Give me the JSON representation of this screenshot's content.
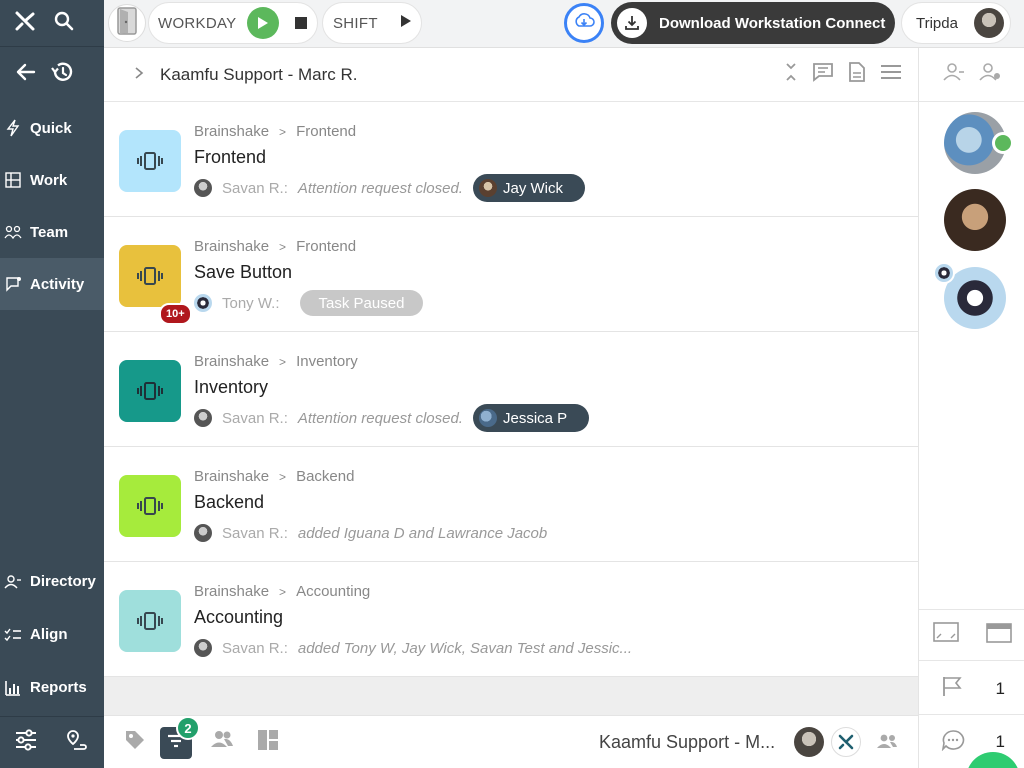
{
  "topbar": {
    "workday_label": "WORKDAY",
    "shift_label": "SHIFT",
    "download_label": "Download Workstation Connect",
    "user_name": "Tripda"
  },
  "sidebar": {
    "items": [
      {
        "label": "Quick",
        "icon": "bolt-icon"
      },
      {
        "label": "Work",
        "icon": "grid-icon"
      },
      {
        "label": "Team",
        "icon": "team-icon"
      },
      {
        "label": "Activity",
        "icon": "activity-icon",
        "active": true
      }
    ],
    "bottom_items": [
      {
        "label": "Directory",
        "icon": "directory-icon"
      },
      {
        "label": "Align",
        "icon": "align-icon"
      },
      {
        "label": "Reports",
        "icon": "reports-icon"
      }
    ]
  },
  "header": {
    "title": "Kaamfu Support - Marc R."
  },
  "activities": [
    {
      "project": "Brainshake",
      "section": "Frontend",
      "title": "Frontend",
      "actor": "Savan R.:",
      "message": "Attention request closed.",
      "chip": "Jay Wick",
      "thumb_color": "#b3e5fc"
    },
    {
      "project": "Brainshake",
      "section": "Frontend",
      "title": "Save Button",
      "actor": "Tony W.:",
      "status": "Task Paused",
      "badge": "10+",
      "thumb_color": "#e8c13d"
    },
    {
      "project": "Brainshake",
      "section": "Inventory",
      "title": "Inventory",
      "actor": "Savan R.:",
      "message": "Attention request closed.",
      "chip": "Jessica P",
      "thumb_color": "#16998a"
    },
    {
      "project": "Brainshake",
      "section": "Backend",
      "title": "Backend",
      "actor": "Savan R.:",
      "message": "added Iguana D and Lawrance Jacob",
      "thumb_color": "#a6eb3c"
    },
    {
      "project": "Brainshake",
      "section": "Accounting",
      "title": "Accounting",
      "actor": "Savan R.:",
      "message": "added Tony W, Jay Wick, Savan Test and Jessic...",
      "thumb_color": "#9fdfdc"
    }
  ],
  "bottombar": {
    "filter_count": "2",
    "title": "Kaamfu Support - M..."
  },
  "rightpanel": {
    "flag_count": "1",
    "chat_count": "1"
  }
}
